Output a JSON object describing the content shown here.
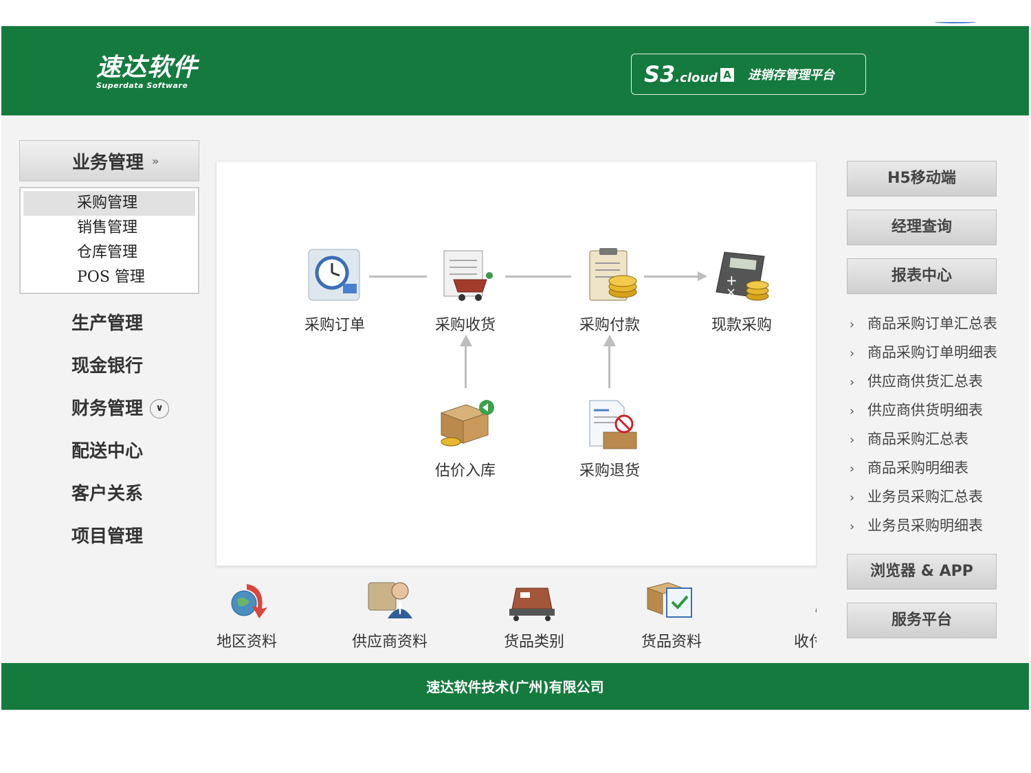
{
  "header": {
    "logo_main": "速达软件",
    "logo_sub": "Superdata Software",
    "product_name": "S3",
    "product_cloud": ".cloud",
    "product_edition": "A",
    "product_tagline": "进销存管理平台"
  },
  "nav": {
    "business_label": "业务管理",
    "submenu": [
      "采购管理",
      "销售管理",
      "仓库管理",
      "POS 管理"
    ],
    "items": [
      "生产管理",
      "现金银行",
      "财务管理",
      "配送中心",
      "客户关系",
      "项目管理"
    ]
  },
  "flow": {
    "purchase_order": "采购订单",
    "purchase_receive": "采购收货",
    "purchase_pay": "采购付款",
    "cash_purchase": "现款采购",
    "estimate_stock_in": "估价入库",
    "purchase_return": "采购退货"
  },
  "quick": [
    "地区资料",
    "供应商资料",
    "货品类别",
    "货品资料",
    "收付"
  ],
  "right": {
    "h5": "H5移动端",
    "manager": "经理查询",
    "report_center": "报表中心",
    "reports": [
      "商品采购订单汇总表",
      "商品采购订单明细表",
      "供应商供货汇总表",
      "供应商供货明细表",
      "商品采购汇总表",
      "商品采购明细表",
      "业务员采购汇总表",
      "业务员采购明细表"
    ],
    "browser_app": "浏览器 & APP",
    "service": "服务平台"
  },
  "footer": {
    "company": "速达软件技术(广州)有限公司"
  },
  "colors": {
    "brand_green": "#157a3e",
    "panel_bg": "#f3f3f3"
  }
}
